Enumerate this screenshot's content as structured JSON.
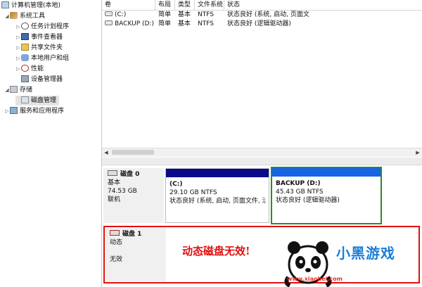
{
  "tree": {
    "items": [
      {
        "label": "计算机管理(本地)",
        "icon": "computer-icon",
        "toggle": "",
        "level": 0,
        "selected": false
      },
      {
        "label": "系统工具",
        "icon": "tools-icon",
        "toggle": "◢",
        "level": 1,
        "selected": false
      },
      {
        "label": "任务计划程序",
        "icon": "clock-icon",
        "toggle": "▷",
        "level": 2,
        "selected": false
      },
      {
        "label": "事件查看器",
        "icon": "events-icon",
        "toggle": "▷",
        "level": 2,
        "selected": false
      },
      {
        "label": "共享文件夹",
        "icon": "share-icon",
        "toggle": "▷",
        "level": 2,
        "selected": false
      },
      {
        "label": "本地用户和组",
        "icon": "users-icon",
        "toggle": "▷",
        "level": 2,
        "selected": false
      },
      {
        "label": "性能",
        "icon": "performance-icon",
        "toggle": "▷",
        "level": 2,
        "selected": false
      },
      {
        "label": "设备管理器",
        "icon": "device-manager-icon",
        "toggle": "",
        "level": 2,
        "selected": false
      },
      {
        "label": "存储",
        "icon": "storage-icon",
        "toggle": "◢",
        "level": 1,
        "selected": false
      },
      {
        "label": "磁盘管理",
        "icon": "disk-icon",
        "toggle": "",
        "level": 2,
        "selected": true
      },
      {
        "label": "服务和应用程序",
        "icon": "services-icon",
        "toggle": "▷",
        "level": 1,
        "selected": false
      }
    ]
  },
  "volume_list": {
    "columns": [
      "卷",
      "布局",
      "类型",
      "文件系统",
      "状态"
    ],
    "rows": [
      {
        "volume": "(C:)",
        "layout": "简单",
        "type": "基本",
        "fs": "NTFS",
        "status": "状态良好 (系统, 启动, 页面文"
      },
      {
        "volume": "BACKUP (D:)",
        "layout": "简单",
        "type": "基本",
        "fs": "NTFS",
        "status": "状态良好 (逻辑驱动器)"
      }
    ]
  },
  "disks": [
    {
      "name": "磁盘 0",
      "type": "基本",
      "size": "74.53 GB",
      "state": "联机",
      "partitions": [
        {
          "name": "(C:)",
          "size": "29.10 GB NTFS",
          "status": "状态良好 (系统, 启动, 页面文件, 活"
        },
        {
          "name": "BACKUP (D:)",
          "size": "45.43 GB NTFS",
          "status": "状态良好 (逻辑驱动器)"
        }
      ]
    },
    {
      "name": "磁盘 1",
      "type": "动态",
      "size": "",
      "state": "无效"
    }
  ],
  "annotation": "动态磁盘无效!",
  "watermark": {
    "logo": "小黑游戏",
    "site": "www.xiaohei.com"
  },
  "colors": {
    "partition_bar": "#0a0a8a",
    "logical_bar": "#1663e6",
    "selection": "#2c8a2c",
    "alert": "#e01010"
  }
}
